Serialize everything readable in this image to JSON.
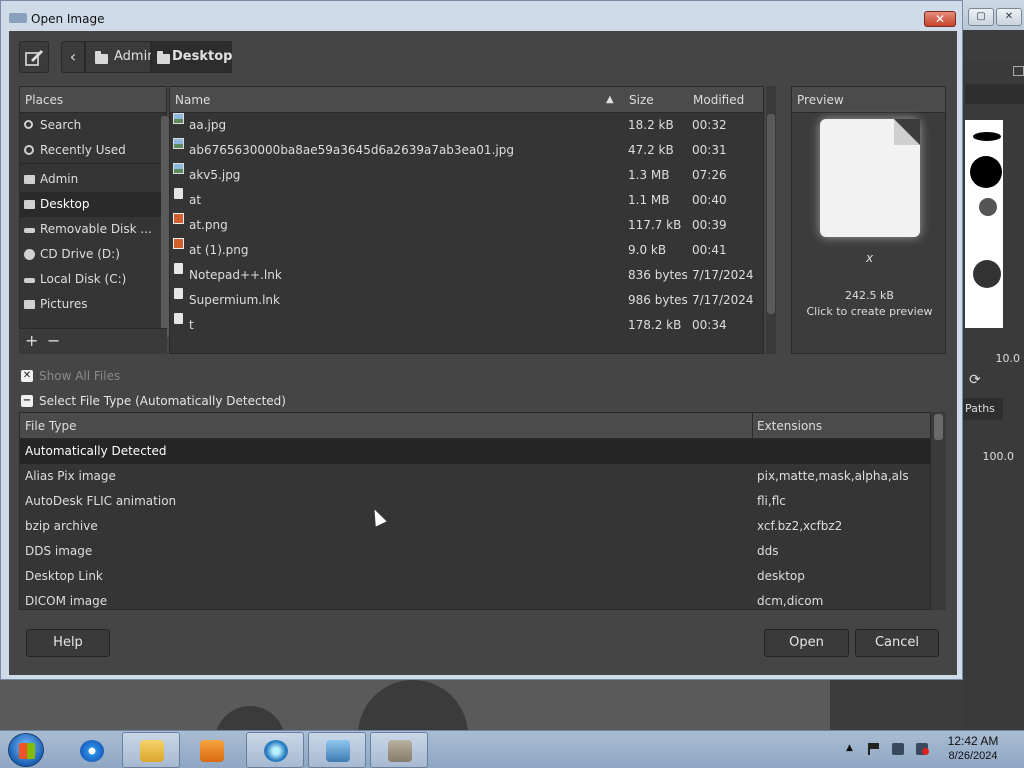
{
  "dialog": {
    "title": "Open Image",
    "close_glyph": "✕"
  },
  "breadcrumb": {
    "back_glyph": "‹",
    "items": [
      {
        "label": "Admin"
      },
      {
        "label": "Desktop",
        "active": true
      }
    ]
  },
  "places": {
    "header": "Places",
    "items": [
      {
        "label": "Search",
        "icon": "search-icon"
      },
      {
        "label": "Recently Used",
        "icon": "recent-icon"
      },
      {
        "label": "Admin",
        "icon": "folder-icon"
      },
      {
        "label": "Desktop",
        "icon": "folder-icon",
        "selected": true
      },
      {
        "label": "Removable Disk ...",
        "icon": "removable-disk-icon"
      },
      {
        "label": "CD Drive (D:)",
        "icon": "cd-drive-icon"
      },
      {
        "label": "Local Disk (C:)",
        "icon": "local-disk-icon"
      },
      {
        "label": "Pictures",
        "icon": "folder-icon"
      }
    ],
    "add_glyph": "+",
    "remove_glyph": "−"
  },
  "files": {
    "columns": {
      "name": "Name",
      "size": "Size",
      "modified": "Modified"
    },
    "sort_glyph": "▲",
    "rows": [
      {
        "name": "aa.jpg",
        "size": "18.2 kB",
        "modified": "00:32",
        "icon": "image-file-icon"
      },
      {
        "name": "ab6765630000ba8ae59a3645d6a2639a7ab3ea01.jpg",
        "size": "47.2 kB",
        "modified": "00:31",
        "icon": "image-file-icon"
      },
      {
        "name": "akv5.jpg",
        "size": "1.3 MB",
        "modified": "07:26",
        "icon": "image-file-icon"
      },
      {
        "name": "at",
        "size": "1.1 MB",
        "modified": "00:40",
        "icon": "file-icon"
      },
      {
        "name": "at.png",
        "size": "117.7 kB",
        "modified": "00:39",
        "icon": "png-file-icon"
      },
      {
        "name": "at (1).png",
        "size": "9.0 kB",
        "modified": "00:41",
        "icon": "png-file-icon"
      },
      {
        "name": "Notepad++.lnk",
        "size": "836 bytes",
        "modified": "7/17/2024",
        "icon": "file-icon"
      },
      {
        "name": "Supermium.lnk",
        "size": "986 bytes",
        "modified": "7/17/2024",
        "icon": "file-icon"
      },
      {
        "name": "t",
        "size": "178.2 kB",
        "modified": "00:34",
        "icon": "file-icon"
      }
    ]
  },
  "preview": {
    "header": "Preview",
    "name": "x",
    "size": "242.5 kB",
    "hint": "Click to create preview"
  },
  "options": {
    "show_all_files": "Show All Files",
    "select_file_type": "Select File Type (Automatically Detected)",
    "check_glyph": "✕",
    "collapse_glyph": "−"
  },
  "file_types": {
    "columns": {
      "type": "File Type",
      "extensions": "Extensions"
    },
    "rows": [
      {
        "type": "Automatically Detected",
        "extensions": "",
        "selected": true
      },
      {
        "type": "Alias Pix image",
        "extensions": "pix,matte,mask,alpha,als"
      },
      {
        "type": "AutoDesk FLIC animation",
        "extensions": "fli,flc"
      },
      {
        "type": "bzip archive",
        "extensions": "xcf.bz2,xcfbz2"
      },
      {
        "type": "DDS image",
        "extensions": "dds"
      },
      {
        "type": "Desktop Link",
        "extensions": "desktop"
      },
      {
        "type": "DICOM image",
        "extensions": "dcm,dicom"
      }
    ]
  },
  "buttons": {
    "help": "Help",
    "open": "Open",
    "cancel": "Cancel"
  },
  "background_app": {
    "value_1": "10.0",
    "paths_tab": "Paths",
    "value_2": "100.0"
  },
  "taskbar": {
    "time": "12:42 AM",
    "date": "8/26/2024"
  }
}
